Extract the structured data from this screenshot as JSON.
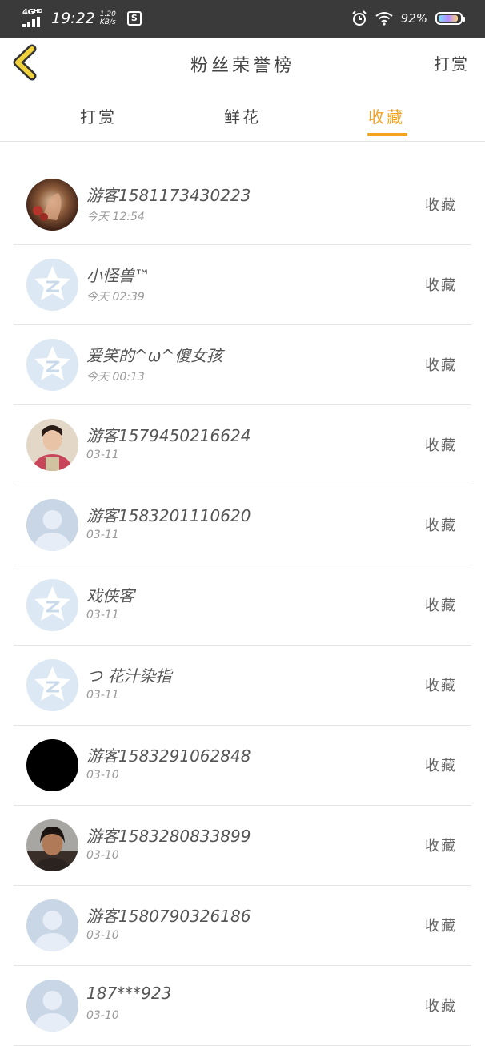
{
  "status_bar": {
    "network": "4G",
    "network_sup": "HD",
    "time": "19:22",
    "speed_value": "1.20",
    "speed_unit": "KB/s",
    "app_icon": "S",
    "battery": "92%"
  },
  "nav": {
    "title": "粉丝荣誉榜",
    "right_action": "打赏"
  },
  "tabs": [
    {
      "label": "打赏",
      "active": false
    },
    {
      "label": "鲜花",
      "active": false
    },
    {
      "label": "收藏",
      "active": true
    }
  ],
  "colors": {
    "accent": "#f4a321",
    "status_bar_bg": "#3a3a3a",
    "back_arrow_fill": "#f1d23c",
    "default_avatar_bg": "#dce8f4"
  },
  "list": [
    {
      "name": "游客1581173430223",
      "date": "今天 12:54",
      "action": "收藏",
      "avatar": "photo-rose"
    },
    {
      "name": "小怪兽™",
      "date": "今天 02:39",
      "action": "收藏",
      "avatar": "qq-default-icon"
    },
    {
      "name": "爱笑的^ω^傻女孩",
      "date": "今天 00:13",
      "action": "收藏",
      "avatar": "qq-default-icon"
    },
    {
      "name": "游客1579450216624",
      "date": "03-11",
      "action": "收藏",
      "avatar": "photo-girl"
    },
    {
      "name": "游客1583201110620",
      "date": "03-11",
      "action": "收藏",
      "avatar": "person-silhouette-icon"
    },
    {
      "name": "戏侠客",
      "date": "03-11",
      "action": "收藏",
      "avatar": "qq-default-icon"
    },
    {
      "name": "つ 花汁染指",
      "date": "03-11",
      "action": "收藏",
      "avatar": "qq-default-icon"
    },
    {
      "name": "游客1583291062848",
      "date": "03-10",
      "action": "收藏",
      "avatar": "black"
    },
    {
      "name": "游客1583280833899",
      "date": "03-10",
      "action": "收藏",
      "avatar": "photo-woman"
    },
    {
      "name": "游客1580790326186",
      "date": "03-10",
      "action": "收藏",
      "avatar": "person-silhouette-icon"
    },
    {
      "name": "187***923",
      "date": "03-10",
      "action": "收藏",
      "avatar": "person-silhouette-icon"
    }
  ]
}
